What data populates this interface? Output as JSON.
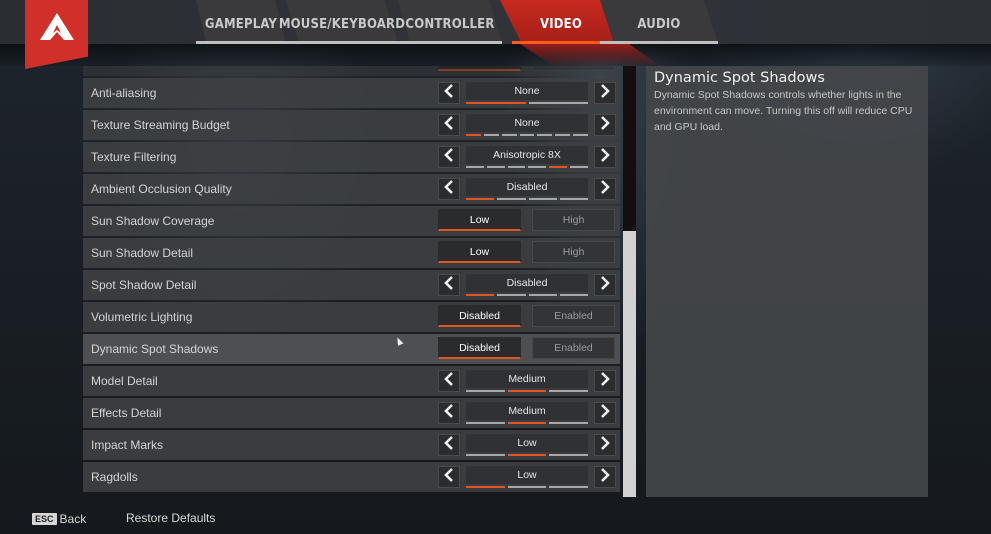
{
  "tabs": [
    {
      "label": "GAMEPLAY",
      "active": false
    },
    {
      "label": "MOUSE/KEYBOARD",
      "active": false
    },
    {
      "label": "CONTROLLER",
      "active": false
    },
    {
      "label": "VIDEO",
      "active": true
    },
    {
      "label": "AUDIO",
      "active": false
    }
  ],
  "colors": {
    "accent": "#e0561f",
    "brand": "#d1302a"
  },
  "settings": [
    {
      "label": "",
      "type": "toggle",
      "options": [
        "",
        ""
      ],
      "selected": 0,
      "partial": true
    },
    {
      "label": "Anti-aliasing",
      "type": "cycler",
      "value": "None",
      "segments": 2,
      "selected": 0
    },
    {
      "label": "Texture Streaming Budget",
      "type": "cycler",
      "value": "None",
      "segments": 7,
      "selected": 0
    },
    {
      "label": "Texture Filtering",
      "type": "cycler",
      "value": "Anisotropic 8X",
      "segments": 6,
      "selected": 4
    },
    {
      "label": "Ambient Occlusion Quality",
      "type": "cycler",
      "value": "Disabled",
      "segments": 4,
      "selected": 0
    },
    {
      "label": "Sun Shadow Coverage",
      "type": "toggle",
      "options": [
        "Low",
        "High"
      ],
      "selected": 0
    },
    {
      "label": "Sun Shadow Detail",
      "type": "toggle",
      "options": [
        "Low",
        "High"
      ],
      "selected": 0
    },
    {
      "label": "Spot Shadow Detail",
      "type": "cycler",
      "value": "Disabled",
      "segments": 4,
      "selected": 0
    },
    {
      "label": "Volumetric Lighting",
      "type": "toggle",
      "options": [
        "Disabled",
        "Enabled"
      ],
      "selected": 0
    },
    {
      "label": "Dynamic Spot Shadows",
      "type": "toggle",
      "options": [
        "Disabled",
        "Enabled"
      ],
      "selected": 0,
      "highlight": true
    },
    {
      "label": "Model Detail",
      "type": "cycler",
      "value": "Medium",
      "segments": 3,
      "selected": 1
    },
    {
      "label": "Effects Detail",
      "type": "cycler",
      "value": "Medium",
      "segments": 3,
      "selected": 1
    },
    {
      "label": "Impact Marks",
      "type": "cycler",
      "value": "Low",
      "segments": 3,
      "selected": 1
    },
    {
      "label": "Ragdolls",
      "type": "cycler",
      "value": "Low",
      "segments": 3,
      "selected": 0
    }
  ],
  "scrollbar": {
    "position_fraction": 0.38,
    "visible_fraction": 0.62
  },
  "description": {
    "title": "Dynamic Spot Shadows",
    "body": "Dynamic Spot Shadows controls whether lights in the environment can move. Turning this off will reduce CPU and GPU load."
  },
  "footer": {
    "esc_key": "ESC",
    "back_label": "Back",
    "restore_label": "Restore Defaults"
  }
}
